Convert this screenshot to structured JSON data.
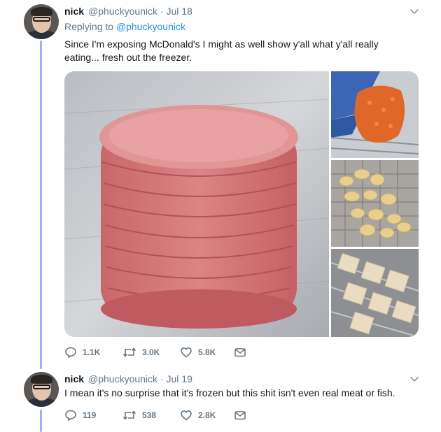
{
  "tweets": [
    {
      "name": "nick",
      "handle": "@phuckyounick",
      "date": "Jul 18",
      "replying_label": "Replying to",
      "replying_to": "@phuckyounick",
      "text_line1": "Since I'm exposing McDonald's I might as well show y'all what y'all really",
      "text_line2": "eating... fresh out the freezer.",
      "replies": "1.1K",
      "retweets": "3.0K",
      "likes": "5.8K"
    },
    {
      "name": "nick",
      "handle": "@phuckyounick",
      "date": "Jul 19",
      "text": "I mean it's no surprise that it's frozen but this shit isn't even real meat or fish.",
      "replies": "119",
      "retweets": "538",
      "likes": "2.8K"
    }
  ],
  "icons": {
    "reply": "speech-bubble-icon",
    "retweet": "retweet-arrows-icon",
    "like": "heart-icon",
    "dm": "envelope-icon",
    "more": "chevron-down-icon"
  },
  "colors": {
    "thread_line": "#a4aef0",
    "link": "#1b95e0",
    "muted": "#657786"
  }
}
